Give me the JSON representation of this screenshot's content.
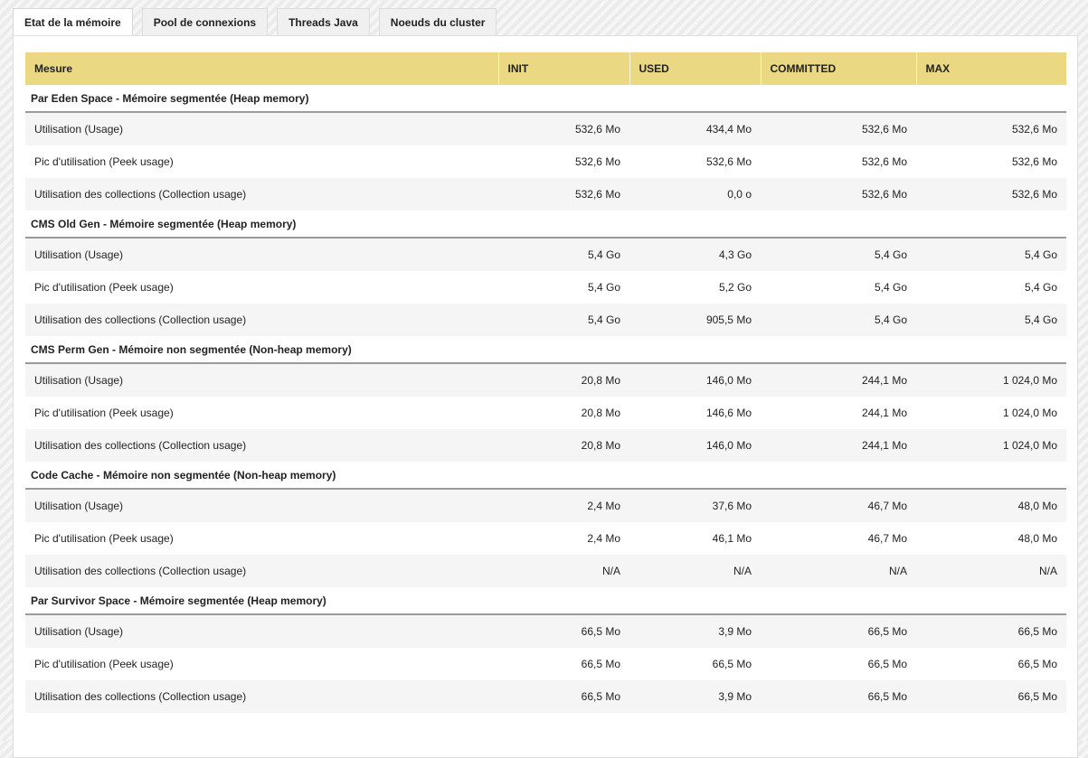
{
  "tabs": [
    "Etat de la mémoire",
    "Pool de connexions",
    "Threads Java",
    "Noeuds du cluster"
  ],
  "columns": [
    "Mesure",
    "INIT",
    "USED",
    "COMMITTED",
    "MAX"
  ],
  "groups": [
    {
      "title": "Par Eden Space - Mémoire segmentée (Heap memory)",
      "rows": [
        {
          "label": "Utilisation (Usage)",
          "init": "532,6 Mo",
          "used": "434,4 Mo",
          "committed": "532,6 Mo",
          "max": "532,6 Mo"
        },
        {
          "label": "Pic d'utilisation (Peek usage)",
          "init": "532,6 Mo",
          "used": "532,6 Mo",
          "committed": "532,6 Mo",
          "max": "532,6 Mo"
        },
        {
          "label": "Utilisation des collections (Collection usage)",
          "init": "532,6 Mo",
          "used": "0,0 o",
          "committed": "532,6 Mo",
          "max": "532,6 Mo"
        }
      ]
    },
    {
      "title": "CMS Old Gen - Mémoire segmentée (Heap memory)",
      "rows": [
        {
          "label": "Utilisation (Usage)",
          "init": "5,4 Go",
          "used": "4,3 Go",
          "committed": "5,4 Go",
          "max": "5,4 Go"
        },
        {
          "label": "Pic d'utilisation (Peek usage)",
          "init": "5,4 Go",
          "used": "5,2 Go",
          "committed": "5,4 Go",
          "max": "5,4 Go"
        },
        {
          "label": "Utilisation des collections (Collection usage)",
          "init": "5,4 Go",
          "used": "905,5 Mo",
          "committed": "5,4 Go",
          "max": "5,4 Go"
        }
      ]
    },
    {
      "title": "CMS Perm Gen - Mémoire non segmentée (Non-heap memory)",
      "rows": [
        {
          "label": "Utilisation (Usage)",
          "init": "20,8 Mo",
          "used": "146,0 Mo",
          "committed": "244,1 Mo",
          "max": "1 024,0 Mo"
        },
        {
          "label": "Pic d'utilisation (Peek usage)",
          "init": "20,8 Mo",
          "used": "146,6 Mo",
          "committed": "244,1 Mo",
          "max": "1 024,0 Mo"
        },
        {
          "label": "Utilisation des collections (Collection usage)",
          "init": "20,8 Mo",
          "used": "146,0 Mo",
          "committed": "244,1 Mo",
          "max": "1 024,0 Mo"
        }
      ]
    },
    {
      "title": "Code Cache - Mémoire non segmentée (Non-heap memory)",
      "rows": [
        {
          "label": "Utilisation (Usage)",
          "init": "2,4 Mo",
          "used": "37,6 Mo",
          "committed": "46,7 Mo",
          "max": "48,0 Mo"
        },
        {
          "label": "Pic d'utilisation (Peek usage)",
          "init": "2,4 Mo",
          "used": "46,1 Mo",
          "committed": "46,7 Mo",
          "max": "48,0 Mo"
        },
        {
          "label": "Utilisation des collections (Collection usage)",
          "init": "N/A",
          "used": "N/A",
          "committed": "N/A",
          "max": "N/A"
        }
      ]
    },
    {
      "title": "Par Survivor Space - Mémoire segmentée (Heap memory)",
      "rows": [
        {
          "label": "Utilisation (Usage)",
          "init": "66,5 Mo",
          "used": "3,9 Mo",
          "committed": "66,5 Mo",
          "max": "66,5 Mo"
        },
        {
          "label": "Pic d'utilisation (Peek usage)",
          "init": "66,5 Mo",
          "used": "66,5 Mo",
          "committed": "66,5 Mo",
          "max": "66,5 Mo"
        },
        {
          "label": "Utilisation des collections (Collection usage)",
          "init": "66,5 Mo",
          "used": "3,9 Mo",
          "committed": "66,5 Mo",
          "max": "66,5 Mo"
        }
      ]
    }
  ]
}
